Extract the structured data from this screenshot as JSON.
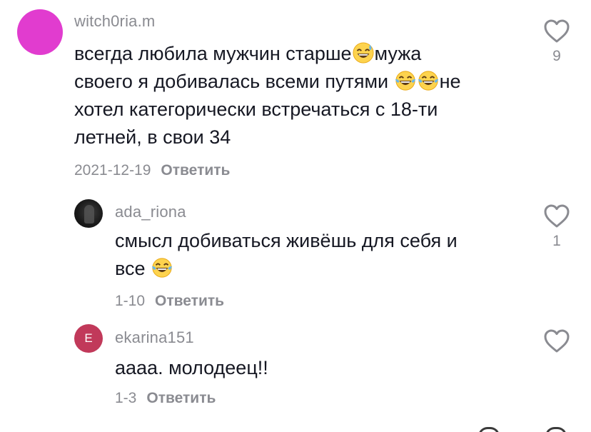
{
  "comments": [
    {
      "username": "witch0ria.m",
      "lines": [
        "всегда любила мужчин старше",
        "мужа",
        "своего я добивалась всеми путями ",
        "не",
        "хотел категорически встречаться с 18-ти",
        "летней, в свои 34"
      ],
      "emoji_names": [
        "grinning-sweat-emoji",
        "tears-of-joy-emoji",
        "tears-of-joy-emoji"
      ],
      "date": "2021-12-19",
      "reply_label": "Ответить",
      "likes": "9"
    },
    {
      "username": "ada_riona",
      "lines": [
        "смысл добиваться живёшь для себя и",
        "все "
      ],
      "emoji_names": [
        "tears-of-joy-emoji"
      ],
      "date": "1-10",
      "reply_label": "Ответить",
      "likes": "1"
    },
    {
      "username": "ekarina151",
      "avatar_letter": "E",
      "lines": [
        "аааа. молодеец!!"
      ],
      "date": "1-3",
      "reply_label": "Ответить",
      "likes": ""
    }
  ],
  "colors": {
    "main_avatar": "#e13ccf",
    "ekarina_avatar": "#c1395a",
    "muted_text": "#8a8b91",
    "body_text": "#161823"
  },
  "icons": {
    "like": "heart-outline-icon"
  }
}
